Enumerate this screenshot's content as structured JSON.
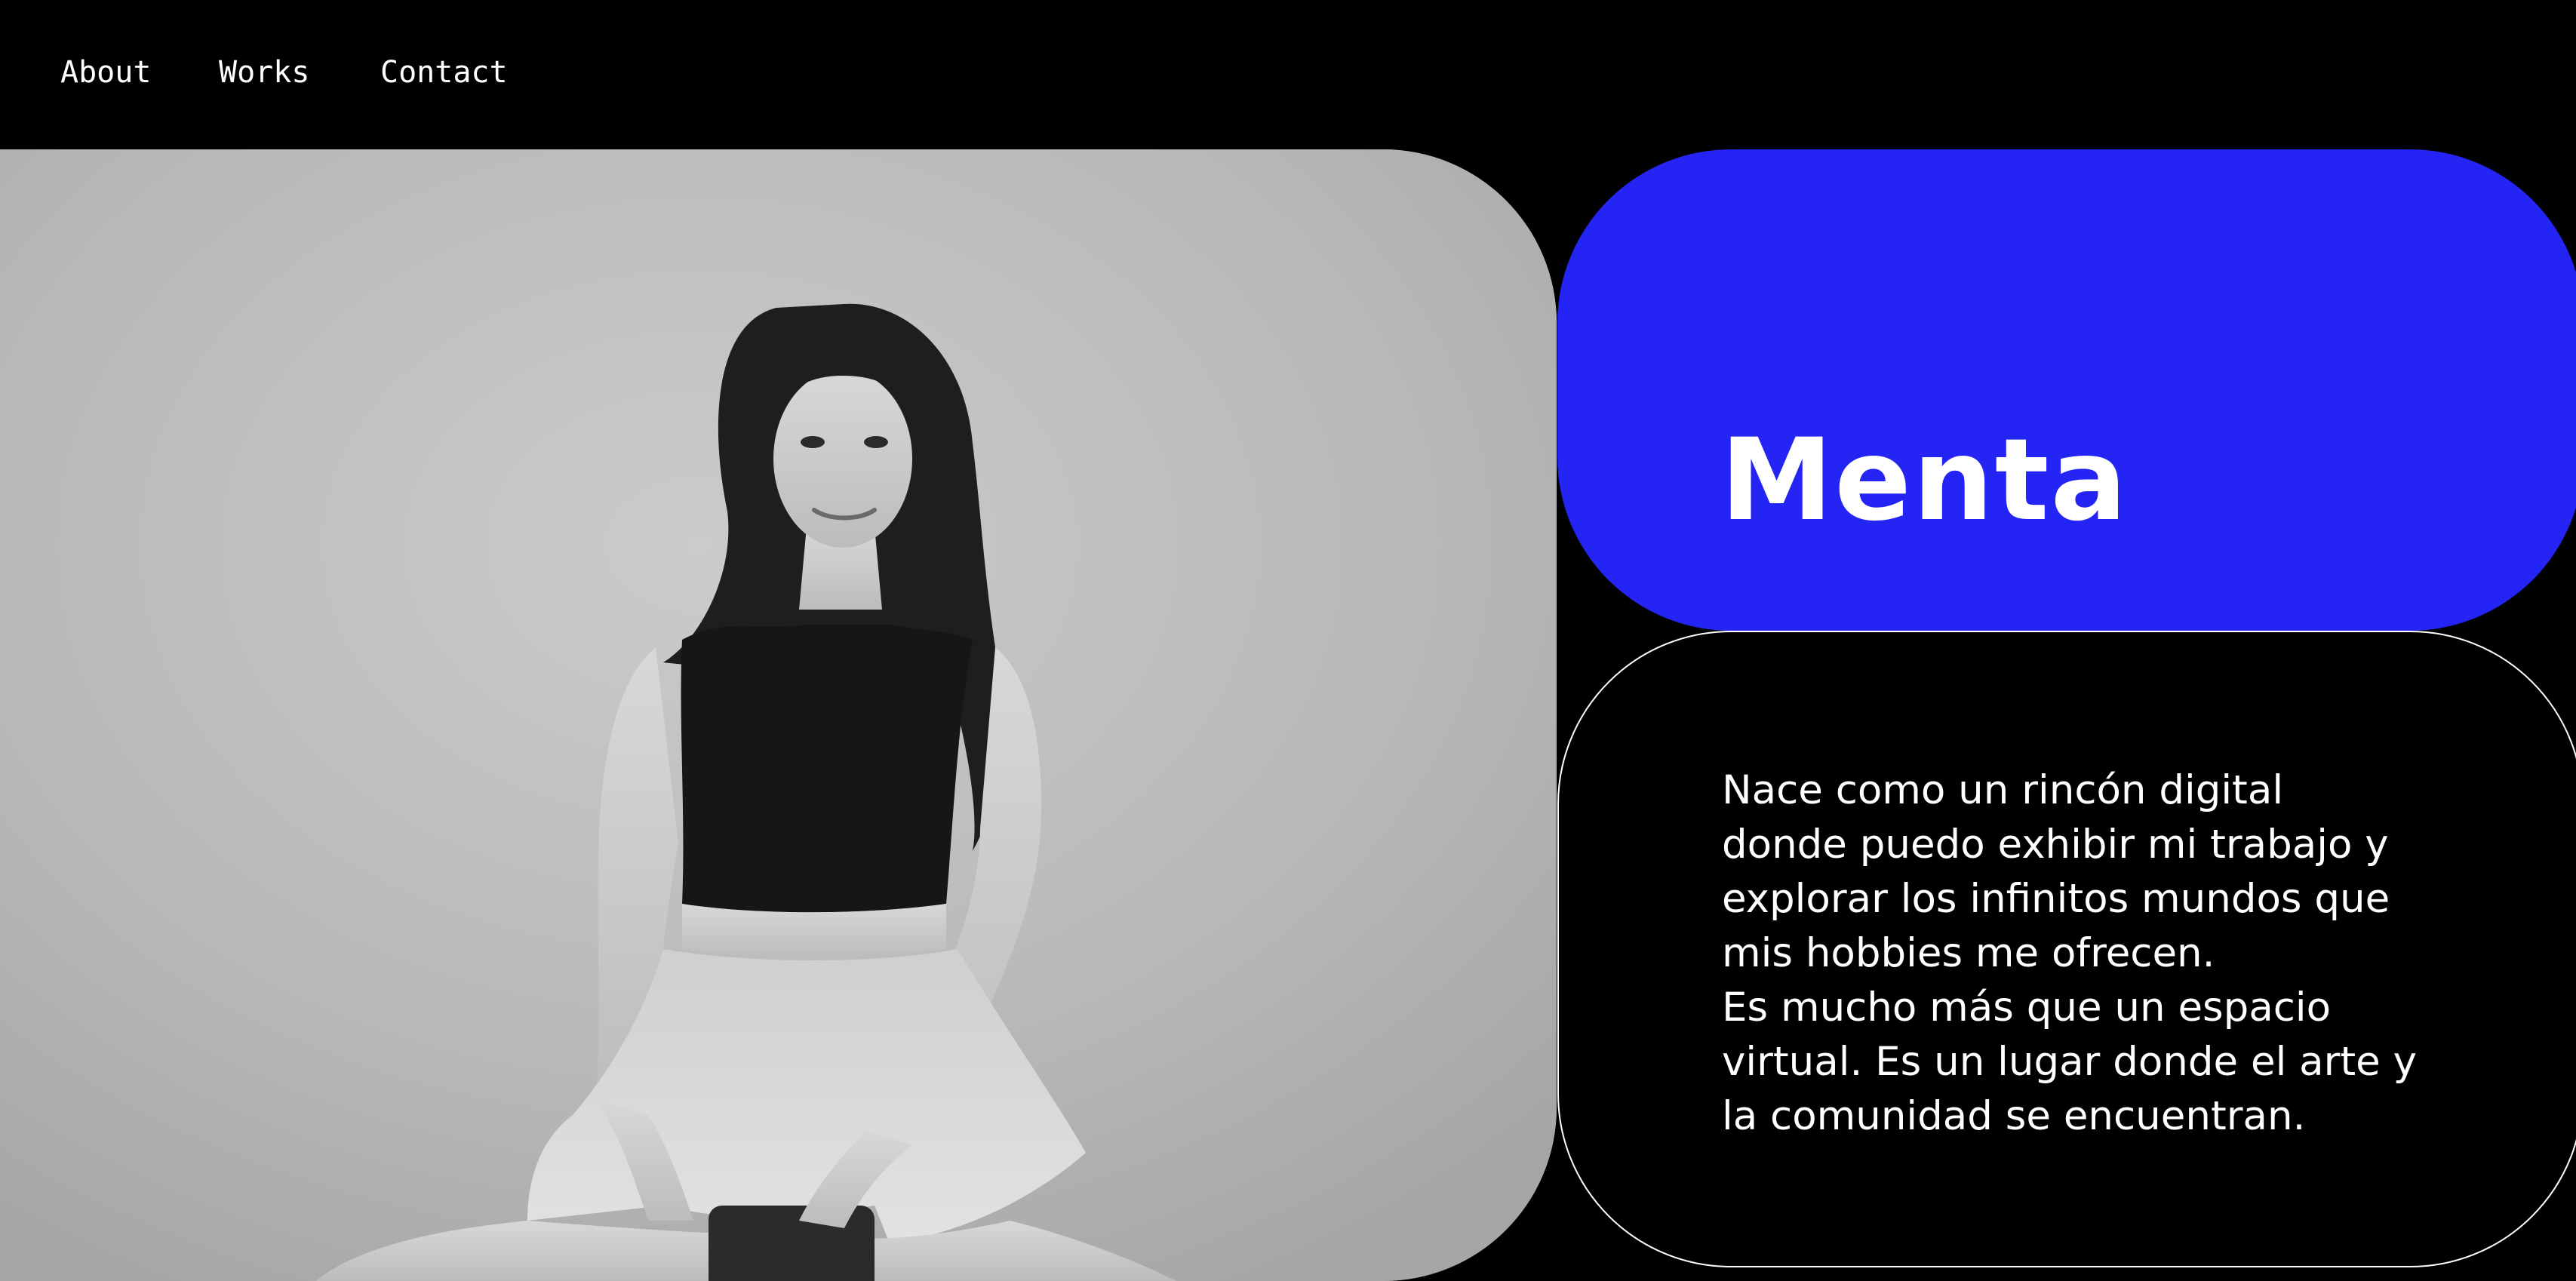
{
  "nav": {
    "items": [
      {
        "label": "About"
      },
      {
        "label": "Works"
      },
      {
        "label": "Contact"
      }
    ]
  },
  "hero": {
    "title": "Menta",
    "description": "Nace como un rincón digital\ndonde puedo exhibir mi trabajo y\nexplorar los infinitos mundos que\nmis hobbies me ofrecen.\nEs mucho más que un espacio\nvirtual. Es un lugar donde el arte y\nla comunidad se encuentran."
  },
  "colors": {
    "background": "#000000",
    "accent": "#2424f5",
    "text": "#ffffff"
  }
}
